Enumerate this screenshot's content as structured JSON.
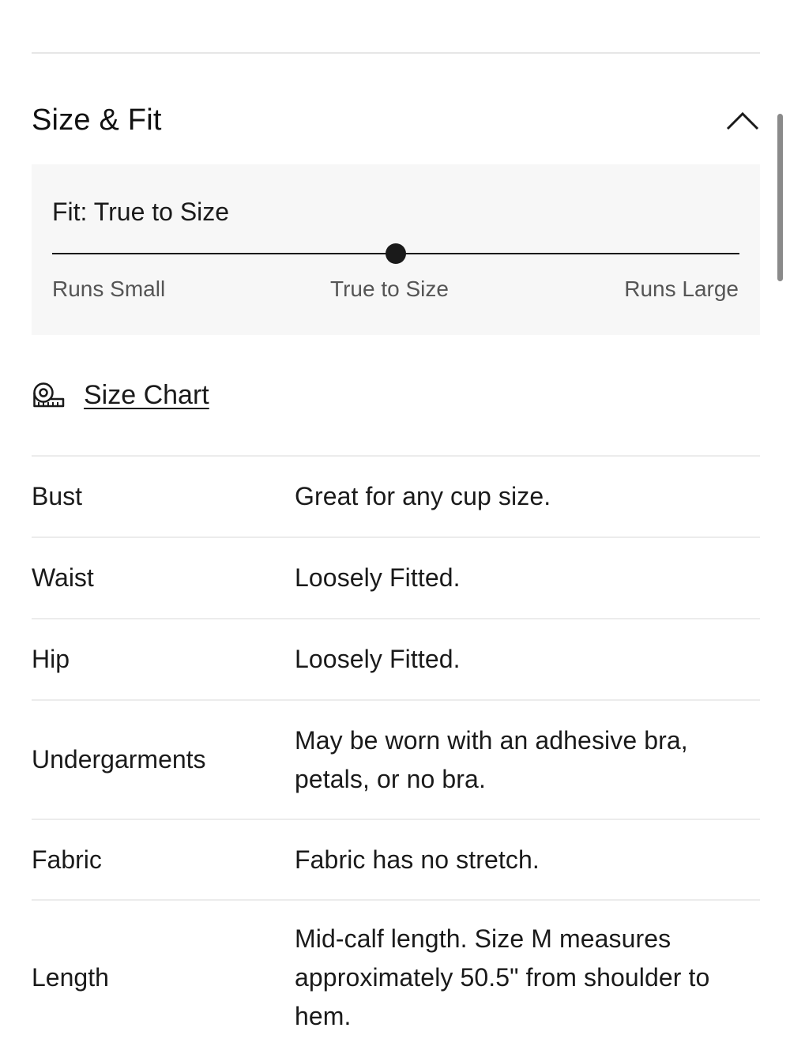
{
  "section": {
    "title": "Size & Fit",
    "toggle_icon": "chevron-up-icon"
  },
  "fit": {
    "label": "Fit: True to Size",
    "scale": [
      "Runs Small",
      "True to Size",
      "Runs Large"
    ],
    "selected_index": 1,
    "slider_position_fraction": 0.5
  },
  "size_chart": {
    "icon": "measuring-tape-icon",
    "label": "Size Chart"
  },
  "details": [
    {
      "label": "Bust",
      "value": "Great for any cup size."
    },
    {
      "label": "Waist",
      "value": "Loosely Fitted."
    },
    {
      "label": "Hip",
      "value": "Loosely Fitted."
    },
    {
      "label": "Undergarments",
      "value": "May be worn with an adhesive bra, petals, or no bra."
    },
    {
      "label": "Fabric",
      "value": "Fabric has no stretch."
    },
    {
      "label": "Length",
      "value": "Mid-calf length. Size M measures approximately 50.5\" from shoulder to hem."
    }
  ],
  "colors": {
    "text": "#1a1a1a",
    "muted_text": "#555555",
    "panel_background": "#f7f7f7",
    "divider": "#ececec"
  }
}
